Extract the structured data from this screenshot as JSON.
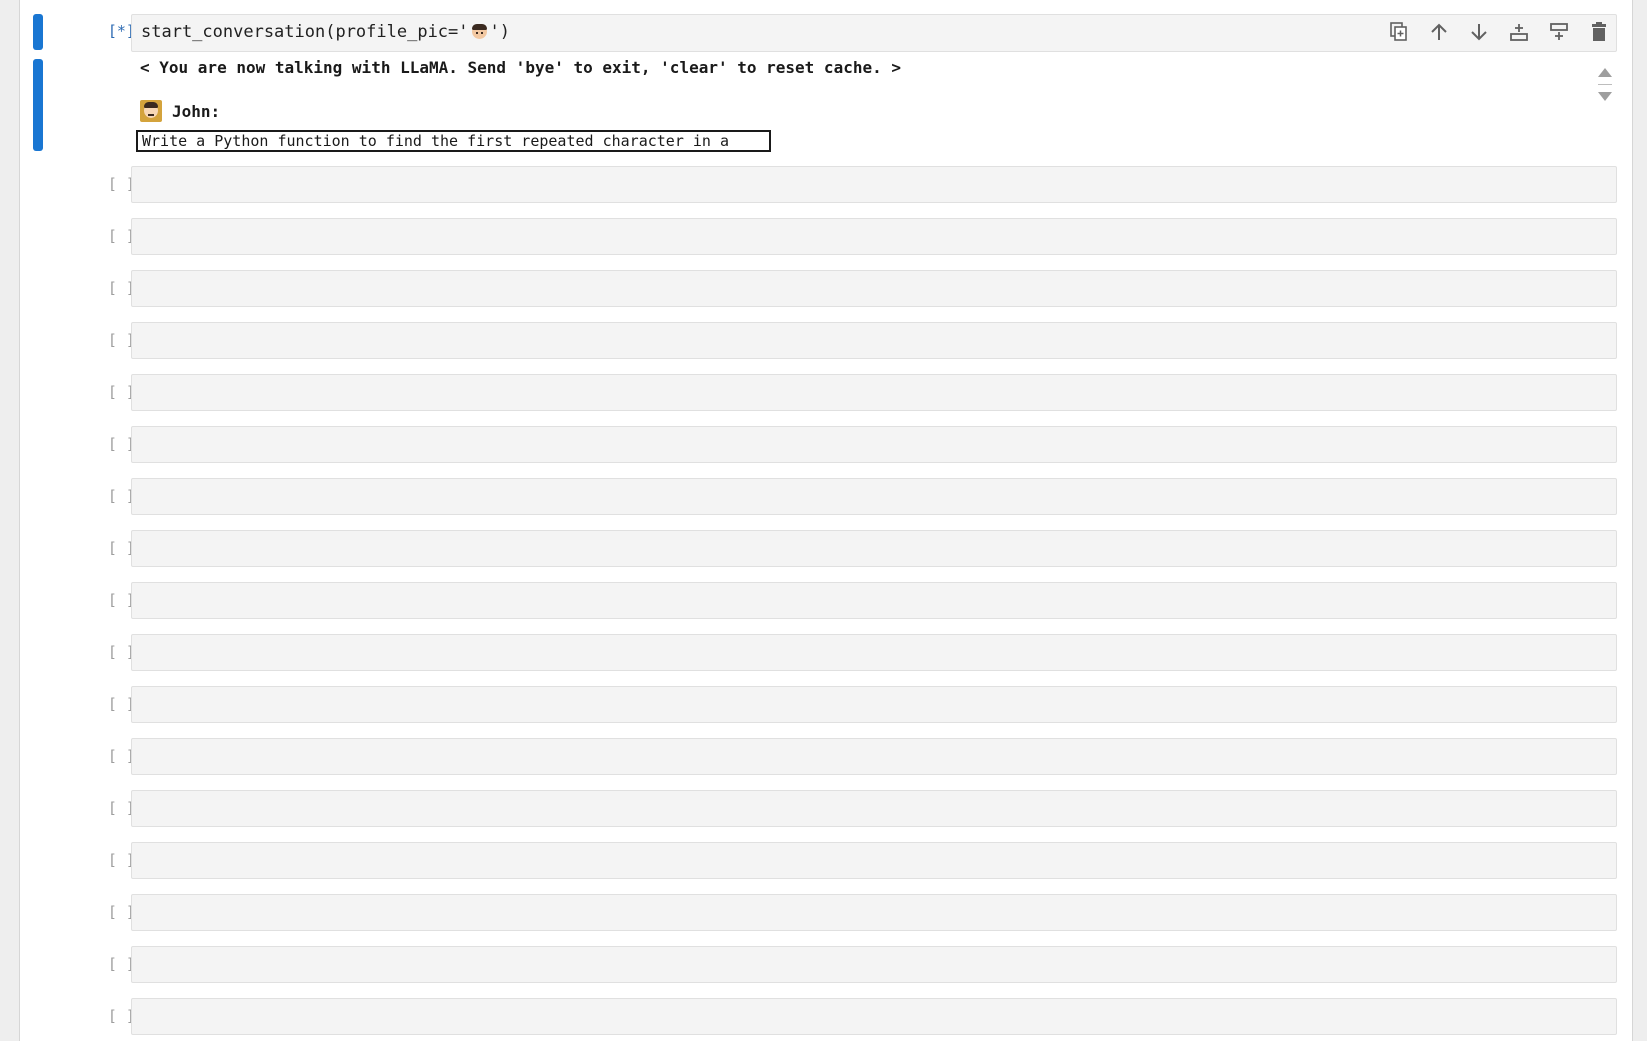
{
  "active_cell": {
    "prompt": "[*]:",
    "code_before": "start_conversation(profile_pic='",
    "code_emoji": "man-face-emoji",
    "code_after": "')",
    "toolbar": {
      "icons": [
        "duplicate-icon",
        "move-up-icon",
        "move-down-icon",
        "insert-below-icon",
        "insert-above-icon",
        "delete-icon"
      ]
    },
    "output": {
      "banner": "< You are now talking with LLaMA. Send 'bye' to exit, 'clear' to reset cache. >",
      "speaker_name": "John:",
      "speaker_avatar": "man-face-emoji",
      "input_value": "Write a Python function to find the first repeated character in a"
    }
  },
  "empty_cells": {
    "prompt": "[ ]:",
    "count": 17
  },
  "colors": {
    "active_bar": "#1976d2",
    "active_prompt": "#2d6bb3",
    "inactive_prompt": "#9e9e9e",
    "cell_background": "#f4f4f4"
  }
}
